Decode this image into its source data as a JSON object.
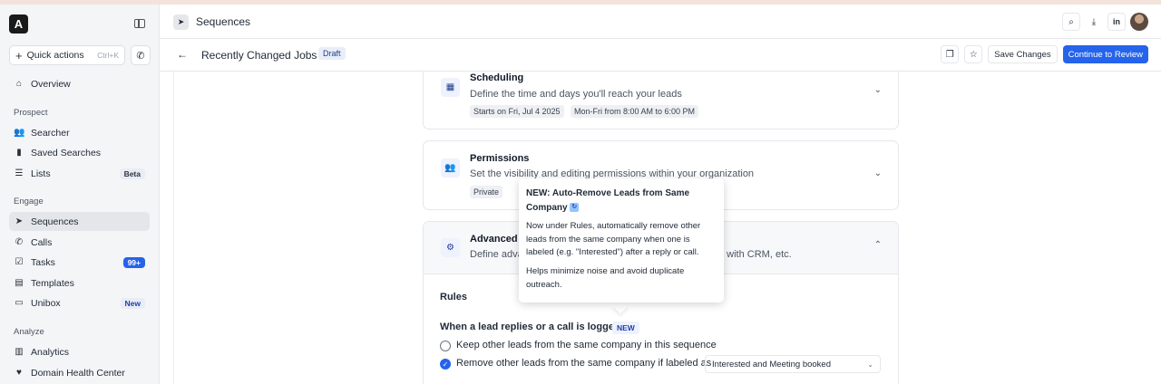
{
  "sidebar": {
    "logo": "A",
    "quick_actions": "Quick actions",
    "quick_shortcut": "Ctrl+K",
    "overview": "Overview",
    "sections": {
      "prospect": "Prospect",
      "engage": "Engage",
      "analyze": "Analyze"
    },
    "prospect_items": [
      {
        "label": "Searcher",
        "icon": "people-icon"
      },
      {
        "label": "Saved Searches",
        "icon": "bookmark-icon"
      },
      {
        "label": "Lists",
        "icon": "list-icon",
        "badge": "Beta"
      }
    ],
    "engage_items": [
      {
        "label": "Sequences",
        "icon": "send-icon"
      },
      {
        "label": "Calls",
        "icon": "phone-icon"
      },
      {
        "label": "Tasks",
        "icon": "checkbox-icon",
        "badge": "99+"
      },
      {
        "label": "Templates",
        "icon": "document-icon"
      },
      {
        "label": "Unibox",
        "icon": "inbox-icon",
        "badge": "New"
      }
    ],
    "analyze_items": [
      {
        "label": "Analytics",
        "icon": "bar-chart-icon"
      },
      {
        "label": "Domain Health Center",
        "icon": "stethoscope-icon"
      }
    ]
  },
  "header": {
    "title": "Sequences",
    "job_title": "Recently Changed Jobs",
    "status": "Draft",
    "save_label": "Save Changes",
    "continue_label": "Continue to Review"
  },
  "cards": {
    "scheduling": {
      "title": "Scheduling",
      "desc": "Define the time and days you'll reach your leads",
      "chips": [
        "Starts on Fri, Jul 4 2025",
        "Mon-Fri from 8:00 AM to 6:00 PM"
      ]
    },
    "permissions": {
      "title": "Permissions",
      "desc": "Set the visibility and editing permissions within your organization",
      "chip": "Private"
    },
    "advanced": {
      "title_visible": "Advanced S",
      "desc_left": "Define advan",
      "desc_right": "g with CRM, etc."
    }
  },
  "rules": {
    "label": "Rules",
    "question": "When a lead replies or a call is logged",
    "new_tag": "NEW",
    "options": [
      {
        "label": "Keep other leads from the same company in this sequence",
        "checked": false
      },
      {
        "label": "Remove other leads from the same company if labeled as",
        "checked": true
      }
    ],
    "select_value": "Interested and Meeting booked"
  },
  "tooltip": {
    "title": "NEW: Auto-Remove Leads from Same Company",
    "p1": "Now under Rules, automatically remove other leads from the same company when one is labeled (e.g. \"Interested\") after a reply or call.",
    "p2": "Helps minimize noise and avoid duplicate outreach."
  },
  "colors": {
    "accent": "#2563eb",
    "sidebar_bg": "#f4f5f7"
  }
}
